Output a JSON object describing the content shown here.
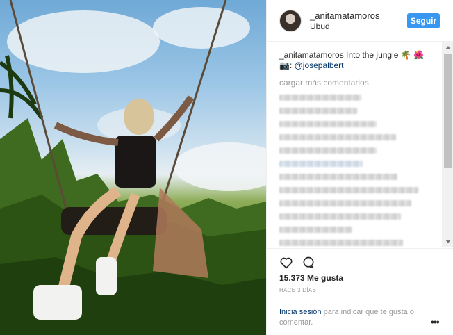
{
  "post": {
    "username": "_anitamatamoros",
    "location": "Ubud",
    "follow_label": "Seguir"
  },
  "caption": {
    "username": "_anitamatamoros",
    "text": " Into the jungle 🌴 🌺",
    "camera_emoji": "📷:",
    "tagged": " @josepalbert"
  },
  "comments": {
    "load_more": "cargar más comentarios"
  },
  "actions": {
    "likes_count": "15.373",
    "likes_label": " Me gusta",
    "time_ago": "HACE 3 DÍAS",
    "login_link": "Inicia sesión",
    "login_rest": " para indicar que te gusta o comentar.",
    "more": "•••"
  },
  "icons": {
    "like": "heart-icon",
    "comment": "comment-icon",
    "options": "more-options-icon"
  },
  "colors": {
    "follow_button": "#3897f0",
    "link": "#003569",
    "muted": "#999999"
  }
}
